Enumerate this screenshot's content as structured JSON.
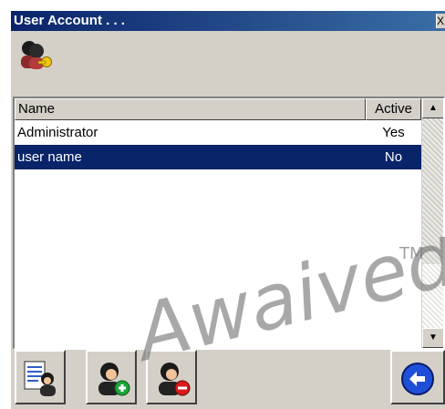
{
  "window": {
    "title": "User Account . . .",
    "close_label": "X"
  },
  "header": {
    "icon": "users-key-icon"
  },
  "grid": {
    "columns": [
      "Name",
      "Active"
    ],
    "rows": [
      {
        "name": "Administrator",
        "active": "Yes",
        "selected": false
      },
      {
        "name": "user name",
        "active": "No",
        "selected": true
      }
    ]
  },
  "scrollbar": {
    "up_glyph": "▲",
    "down_glyph": "▼"
  },
  "toolbar": {
    "buttons": [
      {
        "name": "user-list-button",
        "icon": "user-properties-icon"
      },
      {
        "name": "add-user-button",
        "icon": "add-user-icon"
      },
      {
        "name": "remove-user-button",
        "icon": "remove-user-icon"
      },
      {
        "name": "back-button",
        "icon": "back-arrow-icon"
      }
    ]
  },
  "watermark": {
    "text": "Awaived.com",
    "tm": "TM"
  },
  "colors": {
    "title_bar": "#0a246a",
    "selection": "#0a246a",
    "face": "#d4d0c8",
    "add_badge": "#1ea53a",
    "remove_badge": "#d91a1a",
    "back_blue": "#1f4fd8"
  }
}
